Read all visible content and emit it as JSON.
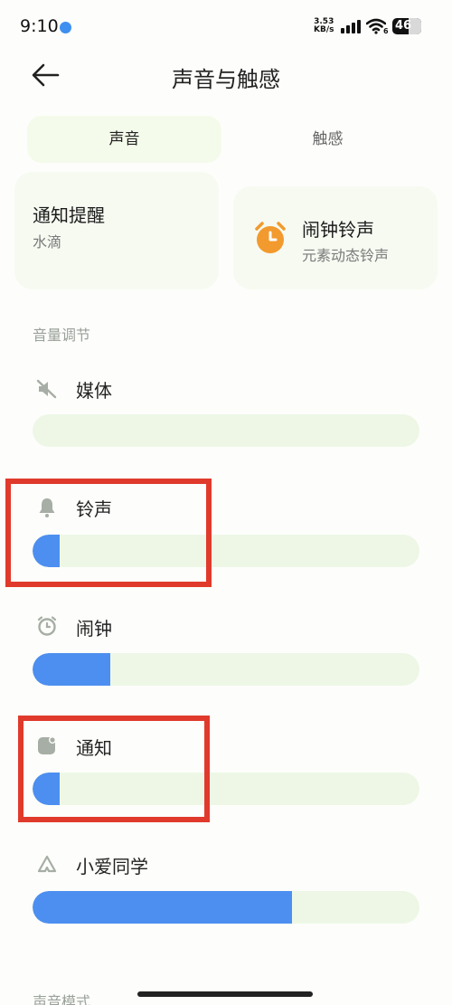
{
  "status": {
    "time": "9:10",
    "net_speed_value": "3.53",
    "net_speed_unit": "KB/s",
    "battery": "46",
    "wifi_badge": "6"
  },
  "header": {
    "title": "声音与触感",
    "back_icon": "arrow-left-icon"
  },
  "tabs": [
    {
      "label": "声音",
      "active": true
    },
    {
      "label": "触感",
      "active": false
    }
  ],
  "cards": {
    "notify": {
      "title": "通知提醒",
      "subtitle": "水滴"
    },
    "alarm": {
      "title": "闹钟铃声",
      "subtitle": "元素动态铃声",
      "icon": "alarm-clock-icon",
      "icon_color": "#f29a2e"
    }
  },
  "section_volume": "音量调节",
  "volumes": [
    {
      "label": "媒体",
      "icon": "speaker-muted-icon",
      "level": 0.0
    },
    {
      "label": "铃声",
      "icon": "bell-icon",
      "level": 0.07
    },
    {
      "label": "闹钟",
      "icon": "alarm-icon",
      "level": 0.2
    },
    {
      "label": "通知",
      "icon": "notification-icon",
      "level": 0.07
    },
    {
      "label": "小爱同学",
      "icon": "xiaoai-icon",
      "level": 0.67
    }
  ],
  "section_sound_mode": "声音模式",
  "colors": {
    "accent": "#4d8ff0",
    "track": "#eef7e6",
    "highlight_box": "#e03a2c"
  }
}
